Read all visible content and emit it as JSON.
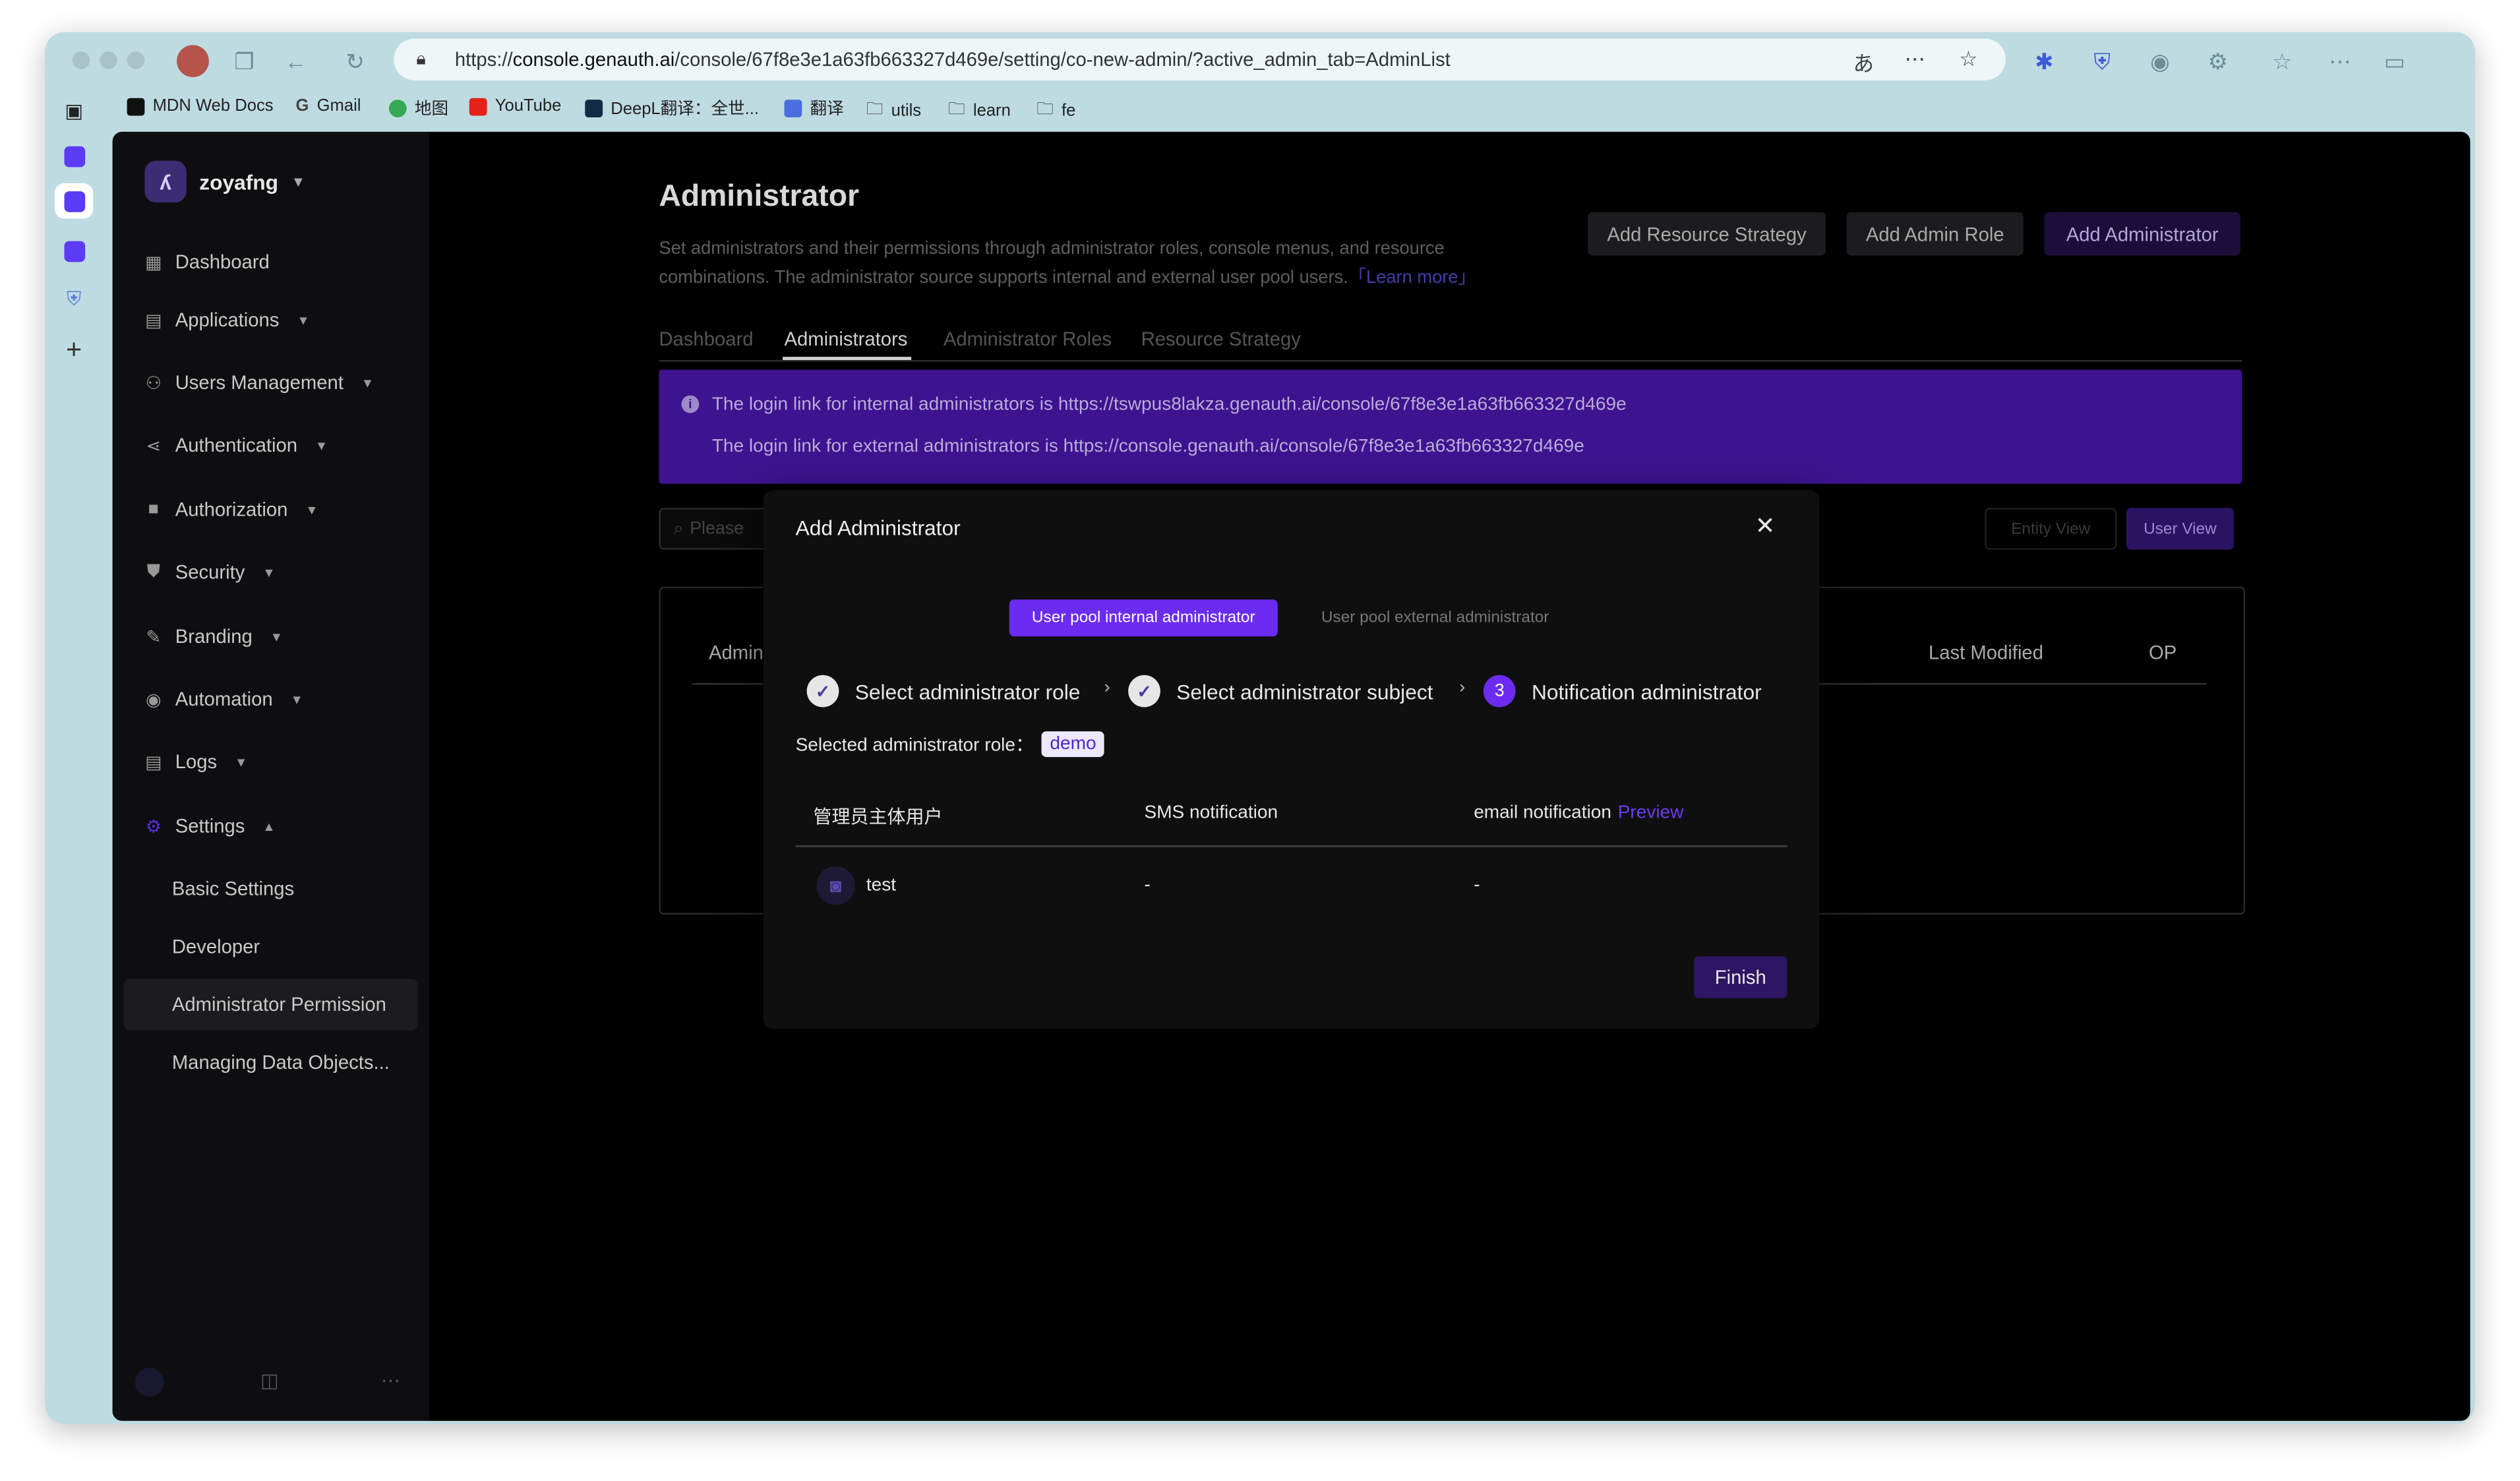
{
  "browser": {
    "url_prefix": "https://",
    "url_host": "console.genauth.ai",
    "url_path": "/console/67f8e3e1a63fb663327d469e/setting/co-new-admin/?active_admin_tab=AdminList",
    "bookmarks": [
      "MDN Web Docs",
      "Gmail",
      "地图",
      "YouTube",
      "DeepL翻译：全世...",
      "翻译",
      "utils",
      "learn",
      "fe"
    ]
  },
  "sidebar": {
    "workspace": "zoyafng",
    "items": [
      {
        "label": "Dashboard",
        "icon": "grid-icon"
      },
      {
        "label": "Applications",
        "icon": "apps-icon"
      },
      {
        "label": "Users Management",
        "icon": "user-icon"
      },
      {
        "label": "Authentication",
        "icon": "share-icon"
      },
      {
        "label": "Authorization",
        "icon": "lock-icon"
      },
      {
        "label": "Security",
        "icon": "shield-icon"
      },
      {
        "label": "Branding",
        "icon": "brush-icon"
      },
      {
        "label": "Automation",
        "icon": "automation-icon"
      },
      {
        "label": "Logs",
        "icon": "logs-icon"
      },
      {
        "label": "Settings",
        "icon": "settings-icon"
      }
    ],
    "settings_sub": [
      "Basic Settings",
      "Developer",
      "Administrator Permission",
      "Managing Data Objects..."
    ]
  },
  "page": {
    "title": "Administrator",
    "description": "Set administrators and their permissions through administrator roles, console menus, and resource combinations. The administrator source supports internal and external user pool users.",
    "learn_more": "「Learn more」",
    "buttons": {
      "add_resource_strategy": "Add Resource Strategy",
      "add_admin_role": "Add Admin Role",
      "add_administrator": "Add Administrator"
    },
    "tabs": [
      "Dashboard",
      "Administrators",
      "Administrator Roles",
      "Resource Strategy"
    ],
    "banner": {
      "internal": "The login link for internal administrators is https://tswpus8lakza.genauth.ai/console/67f8e3e1a63fb663327d469e",
      "external": "The login link for external administrators is https://console.genauth.ai/console/67f8e3e1a63fb663327d469e"
    },
    "search_placeholder": "Please",
    "view_toggle": {
      "entity": "Entity View",
      "user": "User View"
    },
    "table_headers": {
      "admin": "Admin",
      "last_modified": "Last Modified",
      "op": "OP"
    }
  },
  "modal": {
    "title": "Add Administrator",
    "source_tabs": {
      "internal": "User pool internal administrator",
      "external": "User pool external administrator"
    },
    "steps": [
      {
        "label": "Select administrator role",
        "state": "done"
      },
      {
        "label": "Select administrator subject",
        "state": "done"
      },
      {
        "label": "Notification administrator",
        "state": "current",
        "number": "3"
      }
    ],
    "selected_role_label": "Selected administrator role：",
    "selected_role": "demo",
    "table": {
      "headers": {
        "subject": "管理员主体用户",
        "sms": "SMS notification",
        "email": "email notification",
        "preview": "Preview"
      },
      "rows": [
        {
          "name": "test",
          "sms": "-",
          "email": "-"
        }
      ]
    },
    "finish": "Finish"
  },
  "colors": {
    "accent": "#6b2bf0",
    "banner": "#3e138f"
  }
}
